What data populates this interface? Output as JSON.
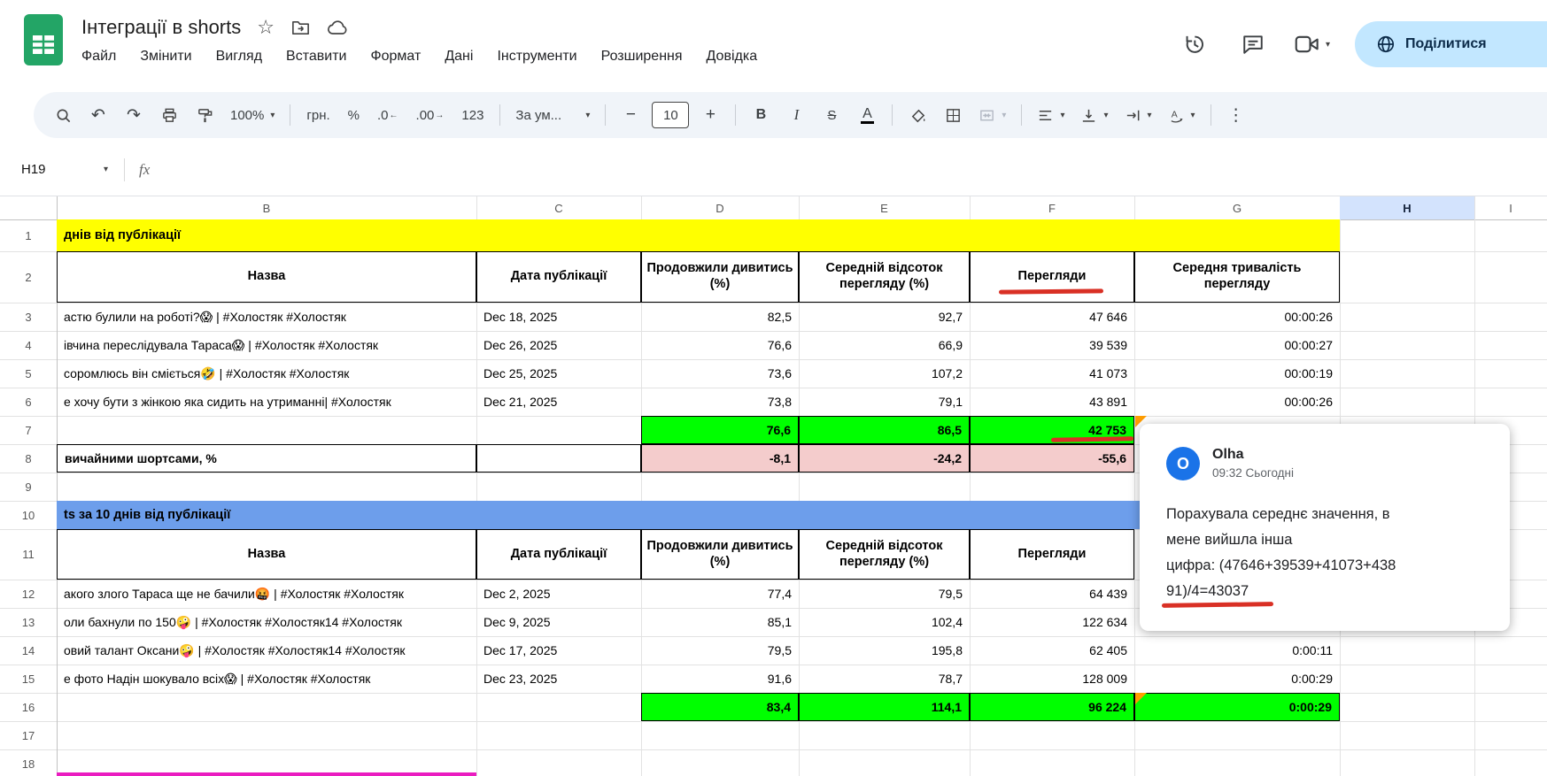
{
  "colors": {
    "share_pill": "#c2e7ff",
    "selected_column_header": "#d3e3fd",
    "section1_band": "#ffff00",
    "section2_band": "#6d9eeb",
    "summary_fill": "#00ff00",
    "diff_fill": "#f4cccc",
    "annotation_red": "#d93025",
    "comment_anchor_orange": "#ff9d00",
    "avatar_blue": "#1a73e8",
    "magenta_border": "#ea1cc0"
  },
  "header": {
    "doc_title": "Інтеграції в shorts",
    "menu_items": [
      "Файл",
      "Змінити",
      "Вигляд",
      "Вставити",
      "Формат",
      "Дані",
      "Інструменти",
      "Розширення",
      "Довідка"
    ],
    "share_label": "Поділитися"
  },
  "toolbar": {
    "zoom_value": "100%",
    "currency": "грн.",
    "percent": "%",
    "decrease_decimal": ".0",
    "increase_decimal": ".00",
    "plain_format": "123",
    "font_name": "За ум...",
    "minus": "−",
    "font_size": "10",
    "plus": "+",
    "bold": "B",
    "italic": "I",
    "strikethrough": "S",
    "text_color": "A"
  },
  "formula_bar": {
    "name_box": "H19",
    "fx_label": "fx"
  },
  "grid": {
    "column_letters": [
      "B",
      "C",
      "D",
      "E",
      "F",
      "G",
      "H",
      "I"
    ],
    "row_numbers": [
      "1",
      "2",
      "3",
      "4",
      "5",
      "6",
      "7",
      "8",
      "9",
      "10",
      "11",
      "12",
      "13",
      "14",
      "15",
      "16",
      "17",
      "18"
    ]
  },
  "sheet": {
    "section1_title": "днів від публікації",
    "section1_headers": {
      "name": "Назва",
      "date": "Дата публікації",
      "continued": "Продовжили дивитись (%)",
      "avg_percent": "Середній відсоток перегляду (%)",
      "views": "Перегляди",
      "avg_duration": "Середня тривалість перегляду"
    },
    "section1_rows": [
      {
        "name": "астю булили на роботі?😱 | #Холостяк #Холостяк",
        "date": "Dec 18, 2025",
        "continued": "82,5",
        "avg_percent": "92,7",
        "views": "47 646",
        "duration": "00:00:26"
      },
      {
        "name": "івчина переслідувала Тараса😱 | #Холостяк #Холостяк",
        "date": "Dec 26, 2025",
        "continued": "76,6",
        "avg_percent": "66,9",
        "views": "39 539",
        "duration": "00:00:27"
      },
      {
        "name": "соромлюсь він сміється🤣 | #Холостяк #Холостяк",
        "date": "Dec 25, 2025",
        "continued": "73,6",
        "avg_percent": "107,2",
        "views": "41 073",
        "duration": "00:00:19"
      },
      {
        "name": "е хочу бути з жінкою яка сидить на утриманні| #Холостяк",
        "date": "Dec 21, 2025",
        "continued": "73,8",
        "avg_percent": "79,1",
        "views": "43 891",
        "duration": "00:00:26"
      }
    ],
    "section1_summary": {
      "continued": "76,6",
      "avg_percent": "86,5",
      "views": "42 753"
    },
    "section1_diff": {
      "label": "вичайними шортсами, %",
      "continued": "-8,1",
      "avg_percent": "-24,2",
      "views": "-55,6"
    },
    "section2_title": "ts за 10 днів від публікації",
    "section2_headers": {
      "name": "Назва",
      "date": "Дата публікації",
      "continued": "Продовжили дивитись (%)",
      "avg_percent": "Середній відсоток перегляду (%)",
      "views": "Перегляди"
    },
    "section2_rows": [
      {
        "name": "акого злого Тараса ще не бачили🤬 | #Холостяк #Холостяк",
        "date": "Dec 2, 2025",
        "continued": "77,4",
        "avg_percent": "79,5",
        "views": "64 439"
      },
      {
        "name": "оли бахнули по 150🤪 | #Холостяк #Холостяк14 #Холостяк",
        "date": "Dec 9, 2025",
        "continued": "85,1",
        "avg_percent": "102,4",
        "views": "122 634"
      },
      {
        "name": "овий талант Оксани🤪 | #Холостяк #Холостяк14 #Холостяк",
        "date": "Dec 17, 2025",
        "continued": "79,5",
        "avg_percent": "195,8",
        "views": "62 405",
        "duration": "0:00:11"
      },
      {
        "name": "е фото Надін шокувало всіх😱 | #Холостяк #Холостяк",
        "date": "Dec 23, 2025",
        "continued": "91,6",
        "avg_percent": "78,7",
        "views": "128 009",
        "duration": "0:00:29"
      }
    ],
    "section2_summary": {
      "continued": "83,4",
      "avg_percent": "114,1",
      "views": "96 224",
      "duration": "0:00:29"
    }
  },
  "comment": {
    "author": "Olha",
    "avatar_letter": "O",
    "timestamp": "09:32 Сьогодні",
    "lines": [
      "Порахувала середнє значення, в",
      "мене вийшла інша",
      "цифра: (47646+39539+41073+438",
      "91)/4=43037"
    ]
  }
}
